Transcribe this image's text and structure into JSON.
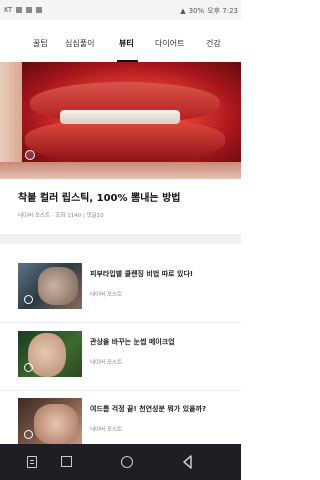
{
  "status_bar": {
    "carrier": "KT",
    "battery": "30%",
    "time": "오후 7:23"
  },
  "tabs": [
    {
      "label": "꿀팁"
    },
    {
      "label": "심심풀이"
    },
    {
      "label": "뷰티"
    },
    {
      "label": "다이어트"
    },
    {
      "label": "건강"
    }
  ],
  "featured": {
    "title": "착붙 컬러 립스틱, 100% 뽐내는 방법",
    "meta": "네이버 포스트 · 조회 1140 | 댓글10"
  },
  "articles": [
    {
      "title": "피부타입별 클렌징 비법 따로 있다!",
      "source": "네이버 포스트"
    },
    {
      "title": "관상을 바꾸는 눈썹 메이크업",
      "source": "네이버 포스트"
    },
    {
      "title": "여드름 걱정 끝! 천연성분 뭐가 있을까?",
      "source": "네이버 포스트"
    }
  ],
  "icons": {
    "nav_menu": "recent-apps-icon",
    "nav_square": "overview-icon",
    "nav_home": "home-icon",
    "nav_back": "back-icon"
  },
  "colors": {
    "active_tab": "#111111",
    "nav_bar": "#1e1e24"
  }
}
